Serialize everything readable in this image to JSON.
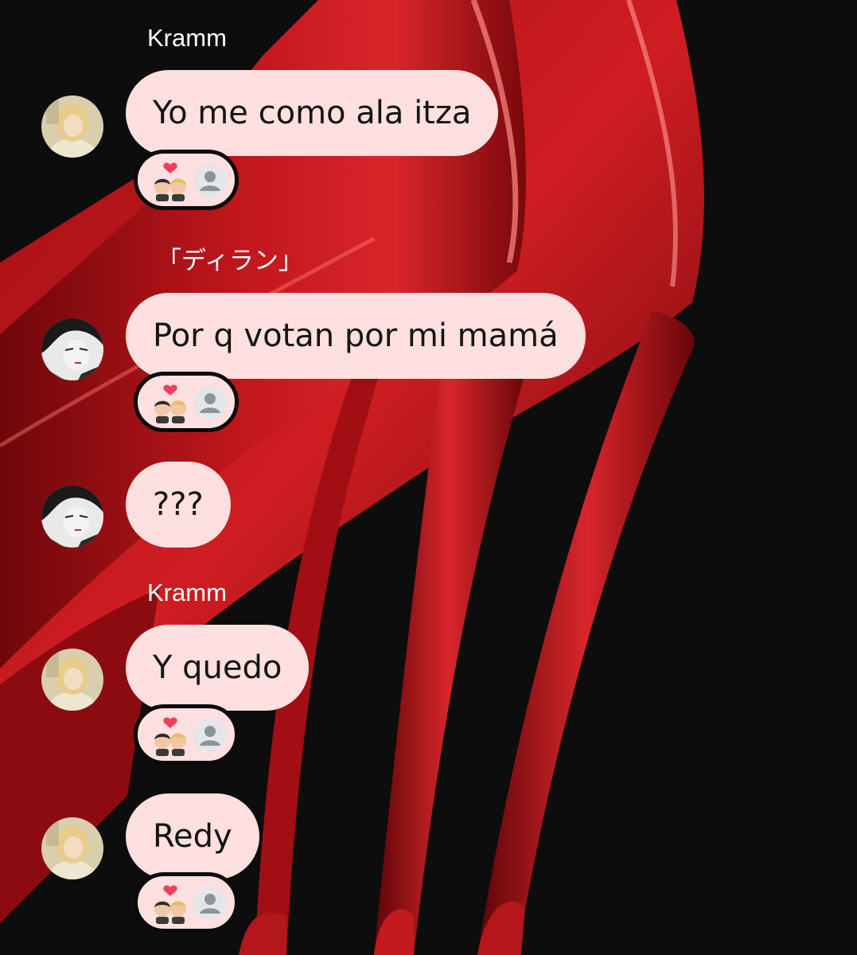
{
  "messages": [
    {
      "sender": "Kramm",
      "text": "Yo me como ala itza",
      "avatar": "blonde-girl-avatar",
      "reactions": [
        "couple-kiss-emoji",
        "default-user-avatar"
      ]
    },
    {
      "sender": "「ディラン」",
      "text": "Por q votan por mi mamá",
      "avatar": "manga-boy-avatar",
      "reactions": [
        "couple-kiss-emoji",
        "default-user-avatar"
      ]
    },
    {
      "sender": "",
      "text": "???",
      "avatar": "manga-boy-avatar",
      "reactions": []
    },
    {
      "sender": "Kramm",
      "text": "Y quedo",
      "avatar": "blonde-girl-avatar",
      "reactions": [
        "couple-kiss-emoji",
        "default-user-avatar"
      ]
    },
    {
      "sender": "",
      "text": "Redy",
      "avatar": "blonde-girl-avatar",
      "reactions": [
        "couple-kiss-emoji",
        "default-user-avatar"
      ]
    }
  ],
  "theme": {
    "bubble_color": "#fde0df",
    "wallpaper": "red-stiletto-heels",
    "wallpaper_primary": "#b8141a",
    "background": "#0d0d0d"
  }
}
